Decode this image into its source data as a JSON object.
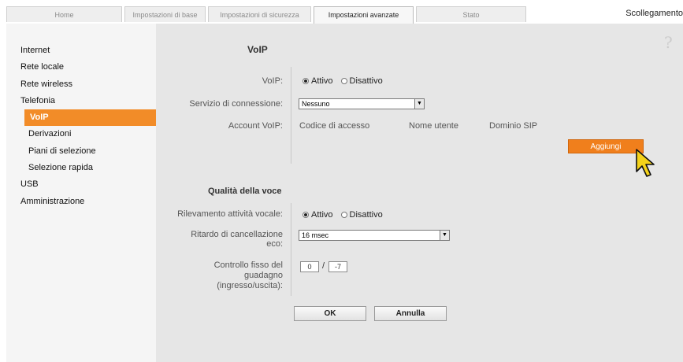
{
  "tabs": [
    "Home",
    "Impostazioni di base",
    "Impostazioni di sicurezza",
    "Impostazioni avanzate",
    "Stato"
  ],
  "active_tab": "Impostazioni avanzate",
  "logout": "Scollegamento",
  "sidebar": {
    "items": [
      {
        "label": "Internet"
      },
      {
        "label": "Rete locale"
      },
      {
        "label": "Rete wireless"
      },
      {
        "label": "Telefonia"
      },
      {
        "label": "VoIP"
      },
      {
        "label": "Derivazioni"
      },
      {
        "label": "Piani di selezione"
      },
      {
        "label": "Selezione rapida"
      },
      {
        "label": "USB"
      },
      {
        "label": "Amministrazione"
      }
    ]
  },
  "help": "?",
  "voip": {
    "title": "VoIP",
    "voip_label": "VoIP:",
    "option_on": "Attivo",
    "option_off": "Disattivo",
    "connection_label": "Servizio di connessione:",
    "connection_value": "Nessuno",
    "account_label": "Account VoIP:",
    "columns": [
      "Codice di accesso",
      "Nome utente",
      "Dominio SIP"
    ],
    "add_button": "Aggiungi"
  },
  "quality": {
    "title": "Qualità della voce",
    "vad_label": "Rilevamento attività vocale:",
    "option_on": "Attivo",
    "option_off": "Disattivo",
    "echo_label_1": "Ritardo di cancellazione",
    "echo_label_2": "eco:",
    "echo_value": "16 msec",
    "gain_label_1": "Controllo fisso del",
    "gain_label_2": "guadagno",
    "gain_label_3": "(ingresso/uscita):",
    "gain_in": "0",
    "gain_out": "-7",
    "slash": "/"
  },
  "buttons": {
    "ok": "OK",
    "cancel": "Annulla"
  },
  "colors": {
    "accent": "#f07f1c",
    "panel": "#e6e6e6",
    "sidebar": "#f5f5f5"
  },
  "icons": {
    "help": "question-mark-icon",
    "cursor": "mouse-pointer-icon",
    "dropdown": "chevron-down-icon"
  }
}
